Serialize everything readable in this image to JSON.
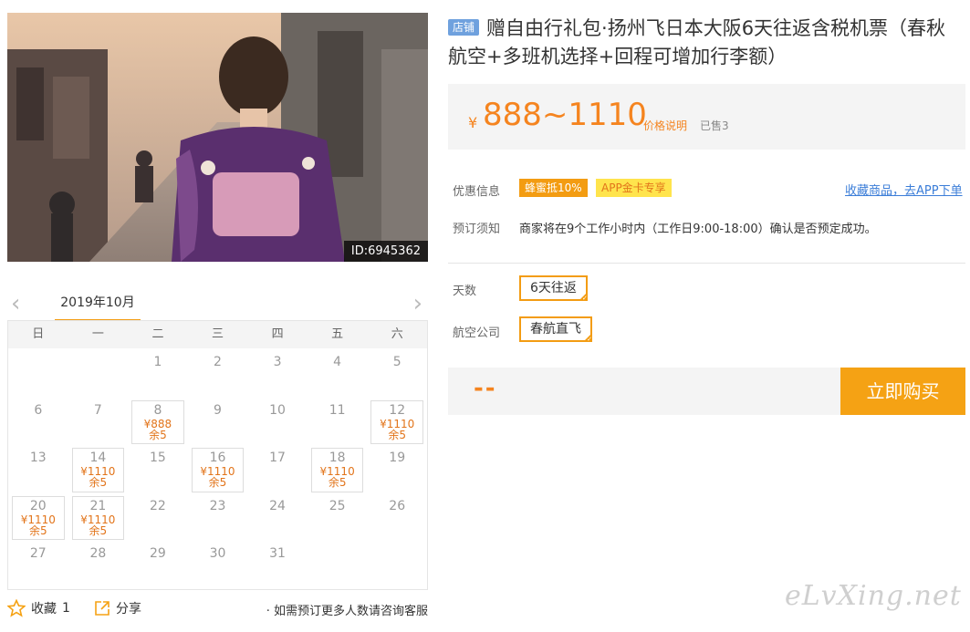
{
  "photo": {
    "id_label": "ID:6945362"
  },
  "calendar": {
    "prev": "‹",
    "next": "›",
    "month": "2019年10月",
    "weekdays": [
      "日",
      "一",
      "二",
      "三",
      "四",
      "五",
      "六"
    ],
    "cells": [
      {
        "day": ""
      },
      {
        "day": ""
      },
      {
        "day": "1"
      },
      {
        "day": "2"
      },
      {
        "day": "3"
      },
      {
        "day": "4"
      },
      {
        "day": "5"
      },
      {
        "day": "6"
      },
      {
        "day": "7"
      },
      {
        "day": "8",
        "price": "¥888",
        "stock": "余5"
      },
      {
        "day": "9"
      },
      {
        "day": "10"
      },
      {
        "day": "11"
      },
      {
        "day": "12",
        "price": "¥1110",
        "stock": "余5"
      },
      {
        "day": "13"
      },
      {
        "day": "14",
        "price": "¥1110",
        "stock": "余5"
      },
      {
        "day": "15"
      },
      {
        "day": "16",
        "price": "¥1110",
        "stock": "余5"
      },
      {
        "day": "17"
      },
      {
        "day": "18",
        "price": "¥1110",
        "stock": "余5"
      },
      {
        "day": "19"
      },
      {
        "day": "20",
        "price": "¥1110",
        "stock": "余5"
      },
      {
        "day": "21",
        "price": "¥1110",
        "stock": "余5"
      },
      {
        "day": "22"
      },
      {
        "day": "23"
      },
      {
        "day": "24"
      },
      {
        "day": "25"
      },
      {
        "day": "26"
      },
      {
        "day": "27"
      },
      {
        "day": "28"
      },
      {
        "day": "29"
      },
      {
        "day": "30"
      },
      {
        "day": "31"
      }
    ]
  },
  "bottom": {
    "favorite_label": "收藏",
    "favorite_count": "1",
    "share_label": "分享",
    "consult": "· 如需预订更多人数请咨询客服"
  },
  "product": {
    "shop_badge": "店铺",
    "title": "赠自由行礼包·扬州飞日本大阪6天往返含税机票（春秋航空+多班机选择+回程可增加行李额）",
    "price_symbol": "¥",
    "price": "888~1110",
    "price_note": "价格说明",
    "sold": "已售3"
  },
  "info": {
    "discount_label": "优惠信息",
    "tag1": "蜂蜜抵10%",
    "tag2": "APP金卡专享",
    "app_link": "收藏商品，去APP下单",
    "notice_label": "预订须知",
    "notice_text": "商家将在9个工作小时内（工作日9:00-18:00）确认是否预定成功。"
  },
  "options": {
    "days_label": "天数",
    "days_value": "6天往返",
    "airline_label": "航空公司",
    "airline_value": "春航直飞"
  },
  "buy": {
    "total": "--",
    "button": "立即购买"
  },
  "watermark": "eLvXing.net",
  "colors": {
    "accent": "#f39c12",
    "price": "#f5841f",
    "link": "#3b7dd8",
    "badge": "#6fa1de"
  }
}
